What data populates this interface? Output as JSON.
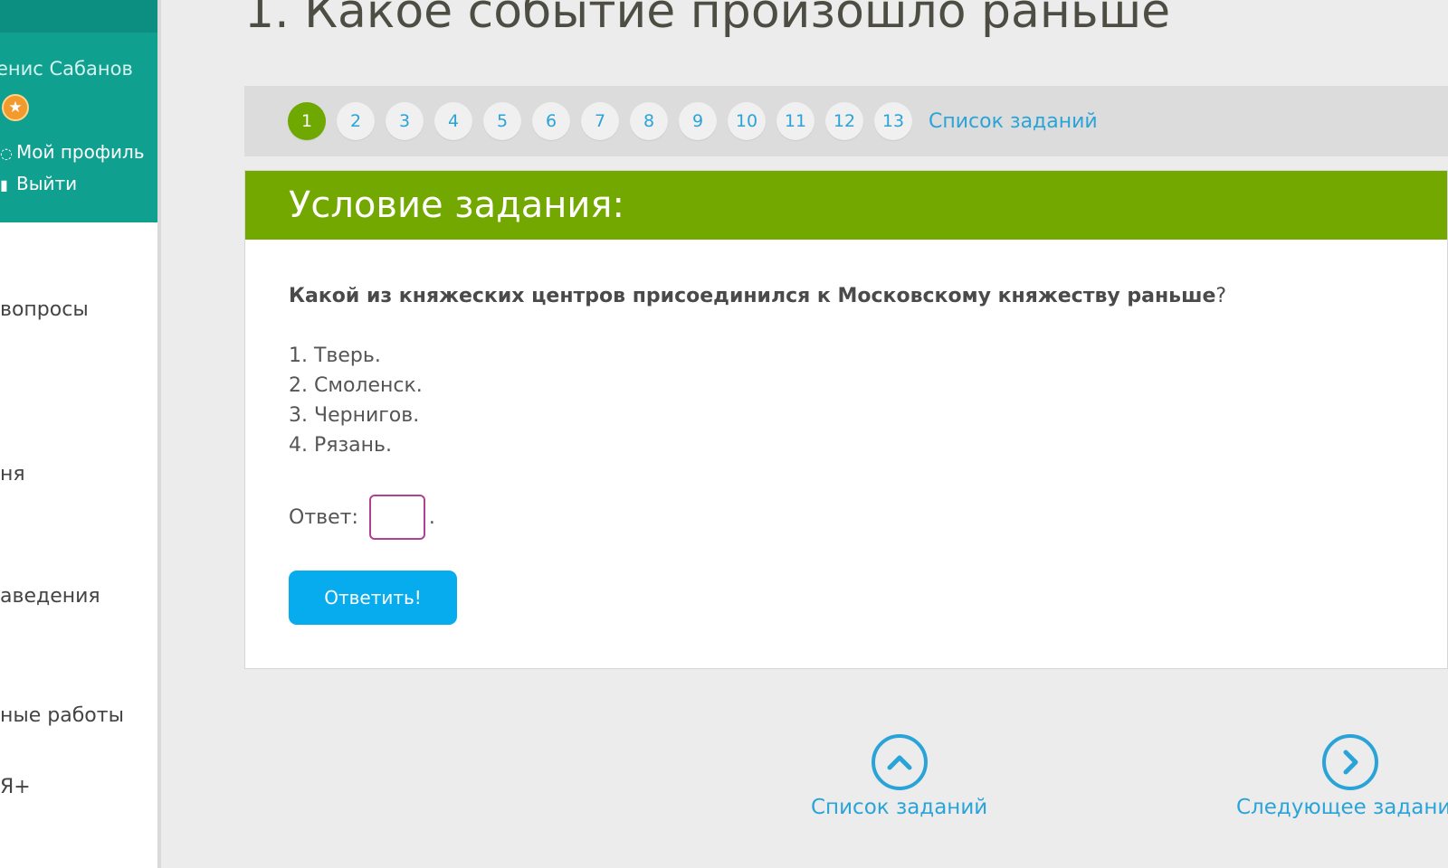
{
  "sidebar": {
    "user_name": "енис Сабанов",
    "star_icon": "★",
    "profile_label": "Мой профиль",
    "logout_label": "Выйти",
    "nav_items": [
      "вопросы",
      "ня",
      "аведения",
      "ные работы",
      "Я+"
    ]
  },
  "page_title": "1. Какое событие произошло раньше",
  "task_nav": {
    "numbers": [
      "1",
      "2",
      "3",
      "4",
      "5",
      "6",
      "7",
      "8",
      "9",
      "10",
      "11",
      "12",
      "13"
    ],
    "active_index": 0,
    "list_link": "Список заданий"
  },
  "panel": {
    "header": "Условие задания:",
    "question": "Какой из княжеских центров присоединился к Московскому княжеству раньше",
    "question_mark": "?",
    "options": [
      "1. Тверь.",
      "2. Смоленск.",
      "3. Чернигов.",
      "4. Рязань."
    ],
    "answer_label": "Ответ:",
    "answer_value": "",
    "answer_suffix": ".",
    "submit_label": "Ответить!"
  },
  "bottom": {
    "list_label": "Список заданий",
    "next_label": "Следующее задание"
  },
  "colors": {
    "sidebar_teal": "#0fa090",
    "header_green": "#72a800",
    "link_blue": "#2aa4d8",
    "button_blue": "#07acef"
  }
}
